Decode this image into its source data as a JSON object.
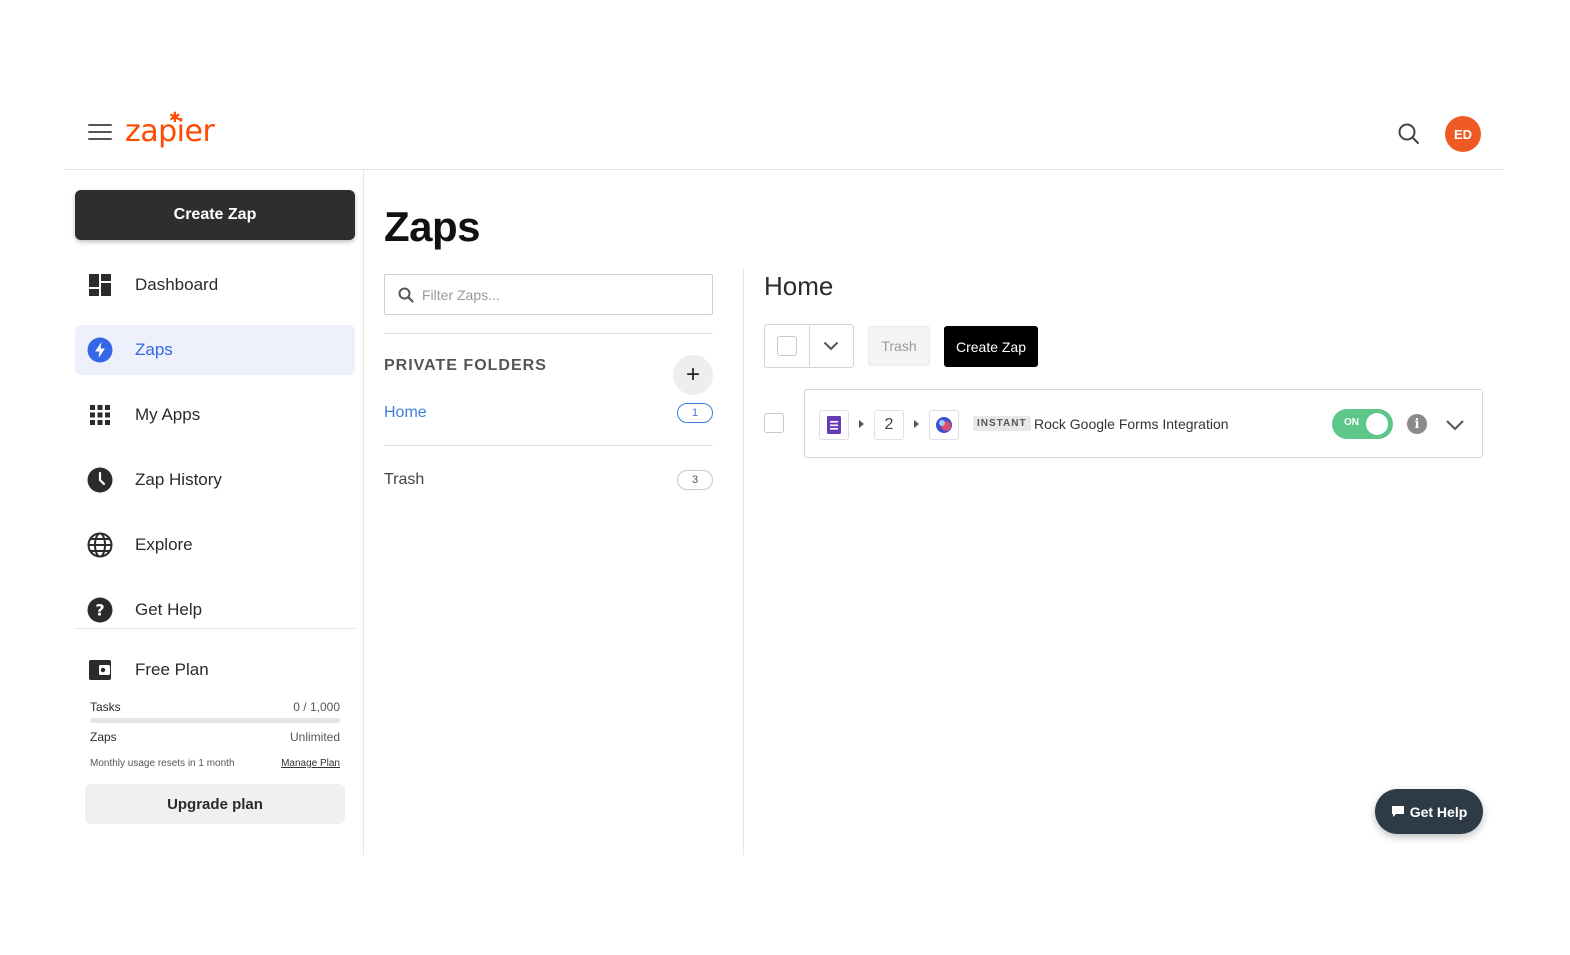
{
  "header": {
    "brand": "zapier",
    "user_initials": "ED"
  },
  "sidebar": {
    "create_zap_label": "Create Zap",
    "items": [
      {
        "label": "Dashboard",
        "icon": "dashboard-icon"
      },
      {
        "label": "Zaps",
        "icon": "bolt-icon",
        "active": true
      },
      {
        "label": "My Apps",
        "icon": "apps-grid-icon"
      },
      {
        "label": "Zap History",
        "icon": "clock-icon"
      },
      {
        "label": "Explore",
        "icon": "globe-icon"
      },
      {
        "label": "Get Help",
        "icon": "help-icon"
      }
    ],
    "plan": {
      "name": "Free Plan",
      "tasks_label": "Tasks",
      "tasks_value": "0 / 1,000",
      "tasks_fraction": 0,
      "zaps_label": "Zaps",
      "zaps_value": "Unlimited",
      "reset_text": "Monthly usage resets in 1 month",
      "manage_label": "Manage Plan",
      "upgrade_label": "Upgrade plan"
    }
  },
  "page": {
    "title": "Zaps",
    "filter_placeholder": "Filter Zaps..."
  },
  "folders": {
    "heading": "PRIVATE FOLDERS",
    "items": [
      {
        "name": "Home",
        "count": "1",
        "active": true
      },
      {
        "name": "Trash",
        "count": "3"
      }
    ]
  },
  "main": {
    "title": "Home",
    "trash_label": "Trash",
    "create_zap_label": "Create Zap",
    "zaps": [
      {
        "steps_count": "2",
        "badge": "INSTANT",
        "name": "Rock Google Forms Integration",
        "status_label": "ON",
        "enabled": true
      }
    ]
  },
  "help_fab": {
    "label": "Get Help"
  },
  "colors": {
    "brand": "#ff4a00",
    "active_nav": "#3466e6",
    "toggle_on": "#5dc78a",
    "avatar": "#ef5a24"
  }
}
